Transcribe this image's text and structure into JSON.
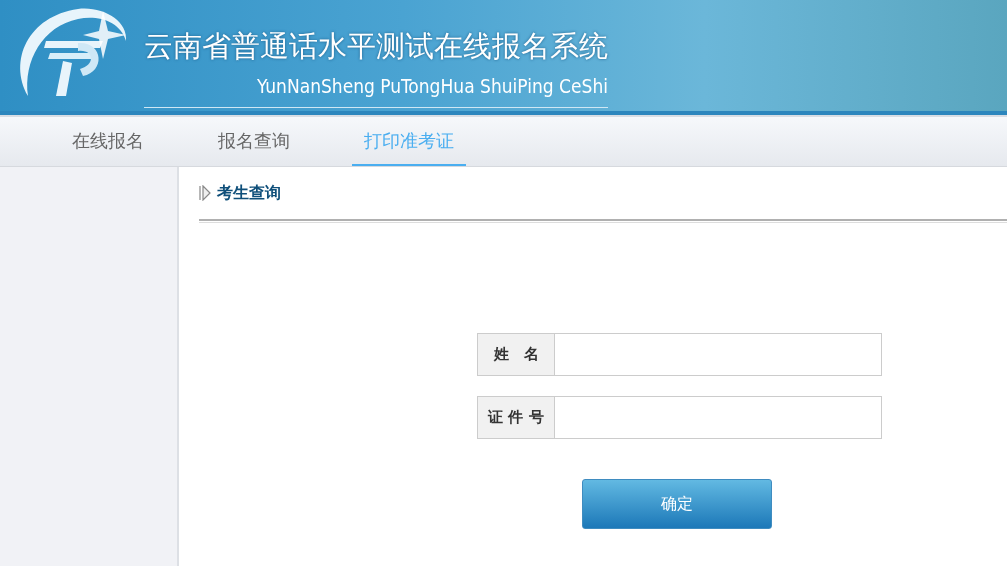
{
  "header": {
    "title": "云南省普通话水平测试在线报名系统",
    "subtitle": "YunNanSheng PuTongHua ShuiPing CeShi"
  },
  "nav": [
    {
      "label": "在线报名",
      "selected": false
    },
    {
      "label": "报名查询",
      "selected": false
    },
    {
      "label": "打印准考证",
      "selected": true
    }
  ],
  "section": {
    "title": "考生查询"
  },
  "form": {
    "fields": [
      {
        "label": "姓　名"
      },
      {
        "label": "证 件 号"
      }
    ],
    "submit": "确定"
  }
}
